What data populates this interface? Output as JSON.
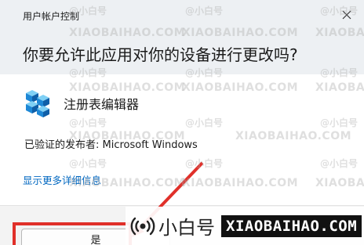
{
  "dialog": {
    "title": "用户帐户控制",
    "question": "你要允许此应用对你的设备进行更改吗?",
    "app_name": "注册表编辑器",
    "publisher": "已验证的发布者: Microsoft Windows",
    "details_link": "显示更多详细信息",
    "yes_label": "是"
  },
  "watermark": {
    "text": "XIAOBAIHAO.COM",
    "handle": "@小白号",
    "brand_cn": "小白号",
    "brand_en": "XIAOBAIHAO.COM"
  },
  "colors": {
    "link": "#0067c0",
    "highlight": "#e0302a",
    "header_bg": "#edf0f3"
  },
  "icons": {
    "close": "close-icon",
    "app": "registry-editor-icon",
    "brand": "broadcast-icon"
  }
}
